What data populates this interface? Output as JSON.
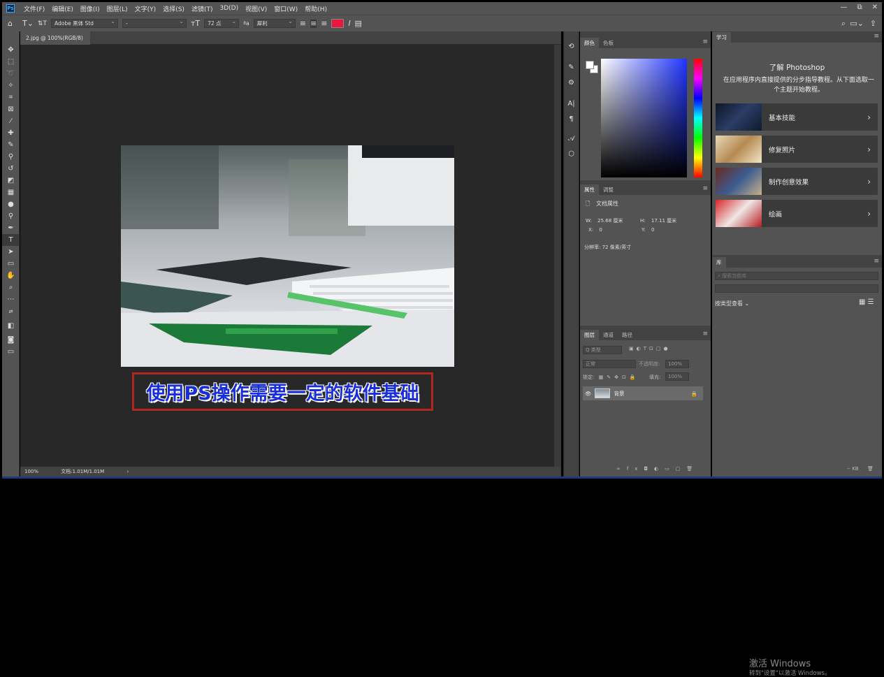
{
  "menubar": {
    "app_icon": "Ps",
    "items": [
      "文件(F)",
      "编辑(E)",
      "图像(I)",
      "图层(L)",
      "文字(Y)",
      "选择(S)",
      "滤镜(T)",
      "3D(D)",
      "视图(V)",
      "窗口(W)",
      "帮助(H)"
    ],
    "window_controls": [
      "—",
      "⧉",
      "✕"
    ]
  },
  "options": {
    "font_family": "Adobe 黑体 Std",
    "font_style": "-",
    "font_size": "72 点",
    "antialias": "犀利",
    "text_color": "#e8173b"
  },
  "document": {
    "tab_label": "2.jpg @ 100%(RGB/8)",
    "tab_close": "×",
    "caption": "使用PS操作需要一定的软件基础",
    "zoom": "100%",
    "doc_info": "文档:1.01M/1.01M",
    "status_arrow": "›"
  },
  "color_panel": {
    "tabs": [
      "颜色",
      "色板"
    ],
    "menu": "≡"
  },
  "properties_panel": {
    "tabs": [
      "属性",
      "调整"
    ],
    "title": "文档属性",
    "w_label": "W:",
    "w_value": "25.68 厘米",
    "h_label": "H:",
    "h_value": "17.11 厘米",
    "x_label": "X:",
    "x_value": "0",
    "y_label": "Y:",
    "y_value": "0",
    "resolution": "分辨率: 72 像素/英寸"
  },
  "layers_panel": {
    "tabs": [
      "图层",
      "通道",
      "路径"
    ],
    "kind_filter": "Q 类型",
    "blend_mode": "正常",
    "opacity_label": "不透明度:",
    "opacity_value": "100%",
    "lock_label": "锁定:",
    "fill_label": "填充:",
    "fill_value": "100%",
    "layer_name": "背景",
    "bottom_icons": [
      "∞",
      "fx",
      "◘",
      "◐",
      "▭",
      "▢",
      "🗑"
    ]
  },
  "learn_panel": {
    "tab": "学习",
    "title": "了解 Photoshop",
    "description": "在应用程序内直接提供的分步指导教程。从下面选取一个主题开始教程。",
    "cards": [
      {
        "label": "基本技能",
        "color": "#1c2a44"
      },
      {
        "label": "修复照片",
        "color": "#c9a77a"
      },
      {
        "label": "制作创意效果",
        "color": "#3b5b8f"
      },
      {
        "label": "绘画",
        "color": "#c7262b"
      }
    ]
  },
  "library_panel": {
    "tab": "库",
    "search_placeholder": "搜索当前库",
    "view_label": "按类型查看",
    "size": "-- KB"
  },
  "watermark": {
    "line1": "激活 Windows",
    "line2": "转到\"设置\"以激活 Windows。"
  }
}
